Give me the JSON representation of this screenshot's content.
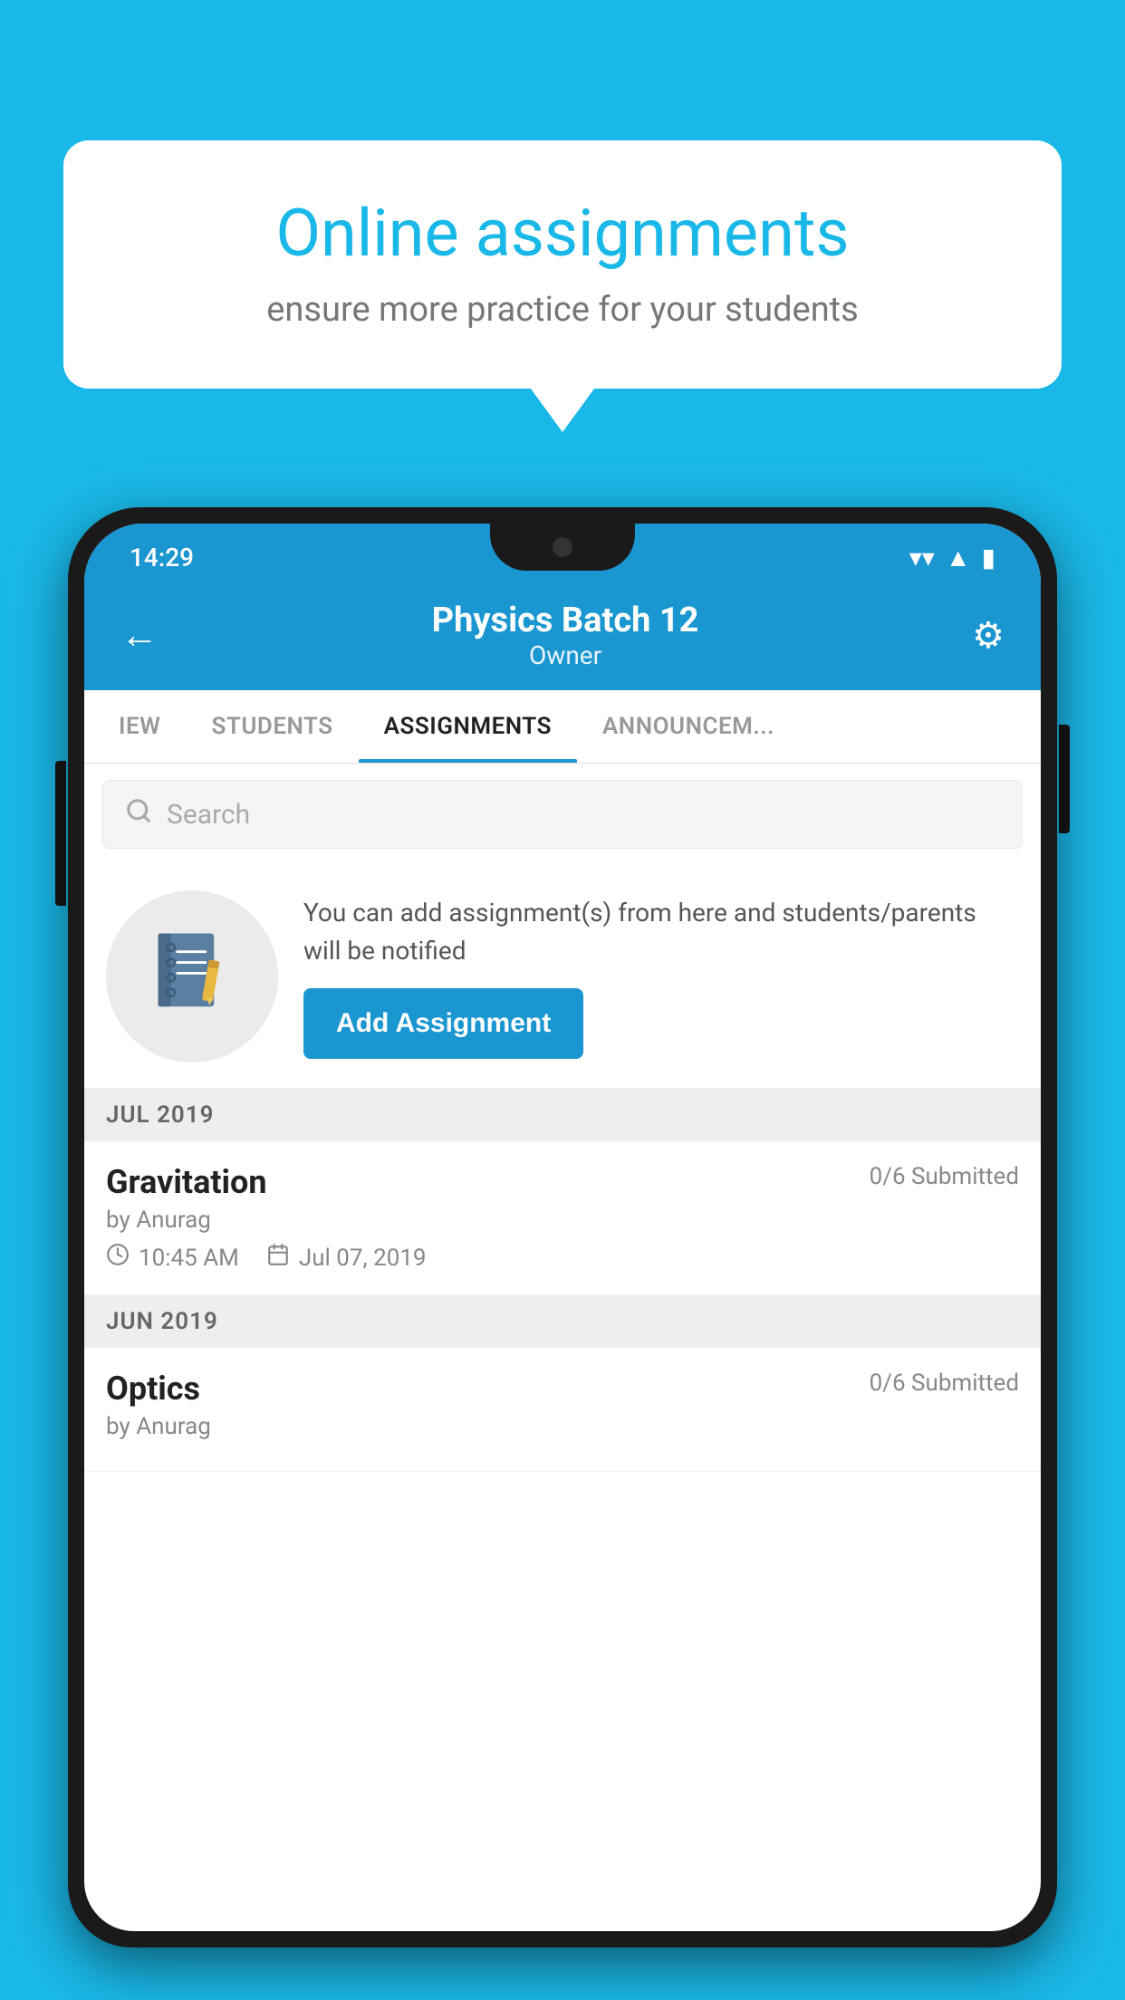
{
  "background_color": "#1ab8e8",
  "speech_bubble": {
    "title": "Online assignments",
    "subtitle": "ensure more practice for your students"
  },
  "phone": {
    "status_bar": {
      "time": "14:29",
      "wifi_icon": "wifi",
      "signal_icon": "signal",
      "battery_icon": "battery"
    },
    "header": {
      "back_label": "←",
      "title": "Physics Batch 12",
      "subtitle": "Owner",
      "settings_icon": "⚙"
    },
    "tabs": [
      {
        "label": "IEW",
        "active": false
      },
      {
        "label": "STUDENTS",
        "active": false
      },
      {
        "label": "ASSIGNMENTS",
        "active": true
      },
      {
        "label": "ANNOUNCEMENTS",
        "active": false
      }
    ],
    "search": {
      "placeholder": "Search"
    },
    "cta": {
      "description": "You can add assignment(s) from here and students/parents will be notified",
      "button_label": "Add Assignment"
    },
    "sections": [
      {
        "header": "JUL 2019",
        "assignments": [
          {
            "name": "Gravitation",
            "status": "0/6 Submitted",
            "author": "by Anurag",
            "time": "10:45 AM",
            "date": "Jul 07, 2019"
          }
        ]
      },
      {
        "header": "JUN 2019",
        "assignments": [
          {
            "name": "Optics",
            "status": "0/6 Submitted",
            "author": "by Anurag",
            "time": "",
            "date": ""
          }
        ]
      }
    ]
  }
}
